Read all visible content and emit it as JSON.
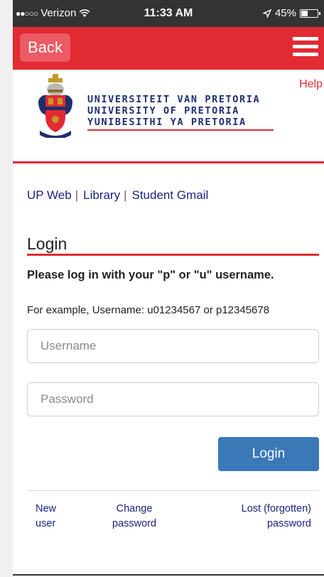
{
  "status_bar": {
    "carrier": "Verizon",
    "time": "11:33 AM",
    "battery": "45%",
    "battery_level": 0.45
  },
  "header": {
    "back_label": "Back",
    "menu_icon": "hamburger-menu-icon",
    "color": "#e22a33"
  },
  "branding": {
    "line1": "UNIVERSITEIT VAN PRETORIA",
    "line2": "UNIVERSITY OF PRETORIA",
    "line3": "YUNIBESITHI YA PRETORIA",
    "help_label": "Help"
  },
  "quick_links": [
    "UP Web",
    "Library",
    "Student Gmail"
  ],
  "login": {
    "title": "Login",
    "instruction": "Please log in with your \"p\" or \"u\" username.",
    "example": "For example, Username: u01234567 or p12345678",
    "username_placeholder": "Username",
    "password_placeholder": "Password",
    "button_label": "Login",
    "button_color": "#3a78b8"
  },
  "footer_links": {
    "new_user_1": "New",
    "new_user_2": "user",
    "change_pw_1": "Change",
    "change_pw_2": "password",
    "lost_pw_1": "Lost (forgotten)",
    "lost_pw_2": "password"
  }
}
